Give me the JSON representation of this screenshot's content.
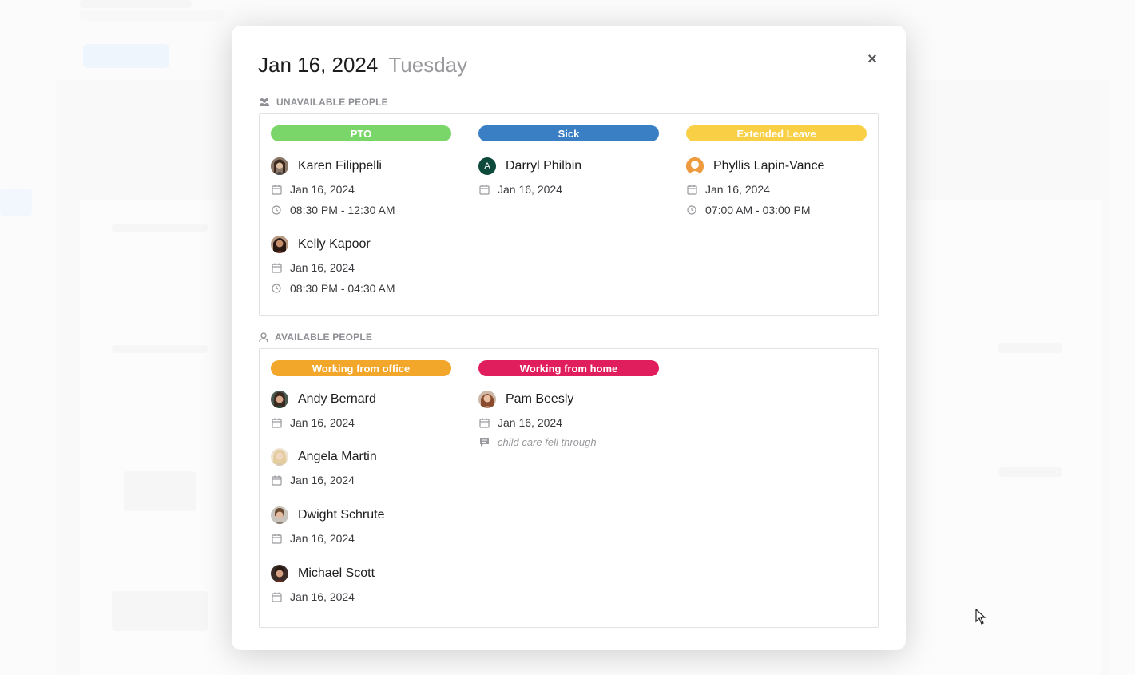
{
  "modal": {
    "date": "Jan 16, 2024",
    "day": "Tuesday",
    "close_label": "×"
  },
  "sections": {
    "unavailable_label": "UNAVAILABLE PEOPLE",
    "available_label": "AVAILABLE PEOPLE"
  },
  "colors": {
    "pto": "#7bd66a",
    "sick": "#3a7fc4",
    "extended_leave": "#f8cf45",
    "working_from_office": "#f2a62a",
    "working_from_home": "#e01d5d"
  },
  "unavailable": {
    "pto": {
      "label": "PTO",
      "people": [
        {
          "name": "Karen Filippelli",
          "date": "Jan 16, 2024",
          "time": "08:30 PM - 12:30 AM"
        },
        {
          "name": "Kelly Kapoor",
          "date": "Jan 16, 2024",
          "time": "08:30 PM - 04:30 AM"
        }
      ]
    },
    "sick": {
      "label": "Sick",
      "people": [
        {
          "name": "Darryl Philbin",
          "initial": "A",
          "date": "Jan 16, 2024"
        }
      ]
    },
    "extended_leave": {
      "label": "Extended Leave",
      "people": [
        {
          "name": "Phyllis Lapin-Vance",
          "date": "Jan 16, 2024",
          "time": "07:00 AM - 03:00 PM"
        }
      ]
    }
  },
  "available": {
    "office": {
      "label": "Working from office",
      "people": [
        {
          "name": "Andy Bernard",
          "date": "Jan 16, 2024"
        },
        {
          "name": "Angela Martin",
          "date": "Jan 16, 2024"
        },
        {
          "name": "Dwight Schrute",
          "date": "Jan 16, 2024"
        },
        {
          "name": "Michael Scott",
          "date": "Jan 16, 2024"
        }
      ]
    },
    "home": {
      "label": "Working from home",
      "people": [
        {
          "name": "Pam Beesly",
          "date": "Jan 16, 2024",
          "note": "child care fell through"
        }
      ]
    }
  }
}
